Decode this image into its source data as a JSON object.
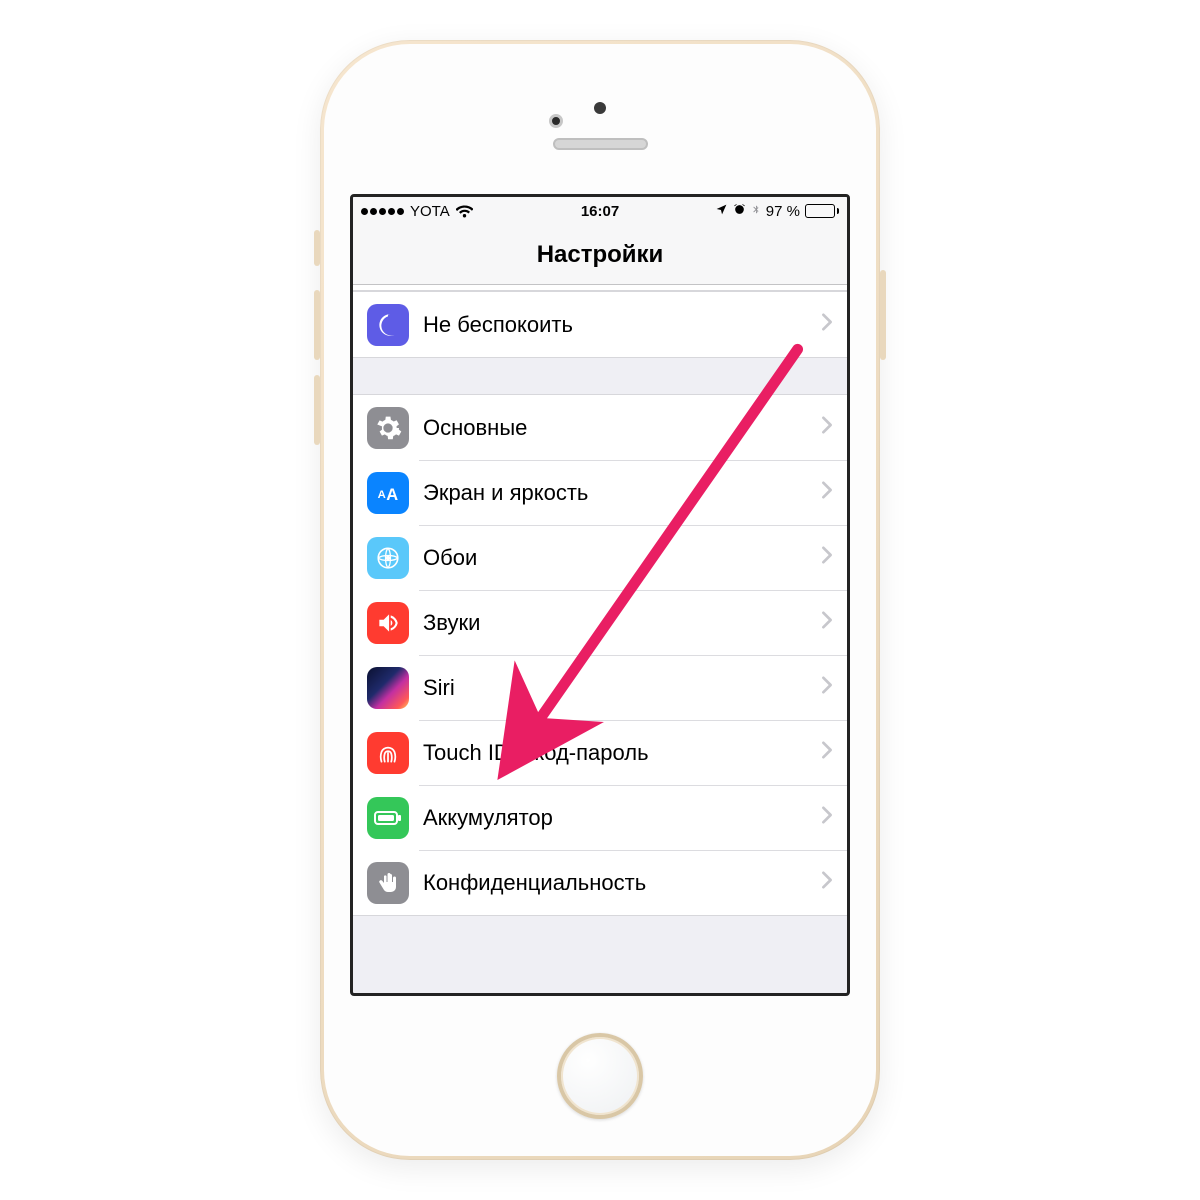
{
  "status_bar": {
    "carrier": "YOTA",
    "time": "16:07",
    "battery_percent": "97 %",
    "battery_level": 97
  },
  "nav": {
    "title": "Настройки"
  },
  "groups": [
    {
      "rows": [
        {
          "icon": "moon-icon",
          "icon_class": "ic-dnd",
          "label": "Не беспокоить"
        }
      ]
    },
    {
      "rows": [
        {
          "icon": "gear-icon",
          "icon_class": "ic-gear",
          "label": "Основные"
        },
        {
          "icon": "display-icon",
          "icon_class": "ic-display",
          "label": "Экран и яркость"
        },
        {
          "icon": "wallpaper-icon",
          "icon_class": "ic-wall",
          "label": "Обои"
        },
        {
          "icon": "speaker-icon",
          "icon_class": "ic-sound",
          "label": "Звуки"
        },
        {
          "icon": "siri-icon",
          "icon_class": "ic-siri",
          "label": "Siri"
        },
        {
          "icon": "fingerprint-icon",
          "icon_class": "ic-touch",
          "label": "Touch ID и код-пароль"
        },
        {
          "icon": "battery-icon",
          "icon_class": "ic-batt",
          "label": "Аккумулятор"
        },
        {
          "icon": "hand-icon",
          "icon_class": "ic-priv",
          "label": "Конфиденциальность"
        }
      ]
    }
  ],
  "annotation": {
    "arrow_color": "#e91e63"
  }
}
